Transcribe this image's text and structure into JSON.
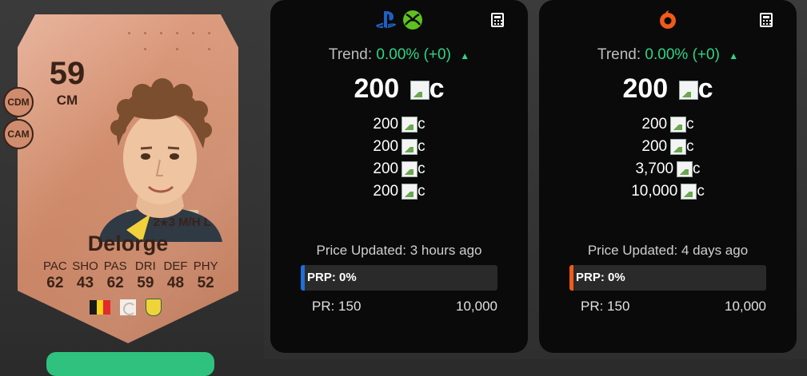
{
  "card": {
    "rating": "59",
    "position": "CM",
    "alt_positions": [
      "CDM",
      "CAM"
    ],
    "skill_moves": "2",
    "weak_foot": "3",
    "work_rates": "M/H",
    "body": "L",
    "name": "Delorge",
    "stat_labels": [
      "PAC",
      "SHO",
      "PAS",
      "DRI",
      "DEF",
      "PHY"
    ],
    "stat_values": [
      "62",
      "43",
      "62",
      "59",
      "48",
      "52"
    ],
    "nation_colors": [
      "#1a1a1a",
      "#f6d21a",
      "#e42a2a"
    ]
  },
  "panels": [
    {
      "platform_icons": [
        "playstation-icon",
        "xbox-icon"
      ],
      "trend_label": "Trend:",
      "trend_value": "0.00% (+0)",
      "main_price": "200",
      "coin_suffix": "c",
      "sub_prices": [
        "200",
        "200",
        "200",
        "200"
      ],
      "updated": "Price Updated: 3 hours ago",
      "prp": "PRP: 0%",
      "prp_color": "#1e6fd9",
      "range_min": "PR: 150",
      "range_max": "10,000"
    },
    {
      "platform_icons": [
        "origin-icon"
      ],
      "trend_label": "Trend:",
      "trend_value": "0.00% (+0)",
      "main_price": "200",
      "coin_suffix": "c",
      "sub_prices": [
        "200",
        "200",
        "3,700",
        "10,000"
      ],
      "updated": "Price Updated: 4 days ago",
      "prp": "PRP: 0%",
      "prp_color": "#f05a1a",
      "range_min": "PR: 150",
      "range_max": "10,000"
    }
  ]
}
